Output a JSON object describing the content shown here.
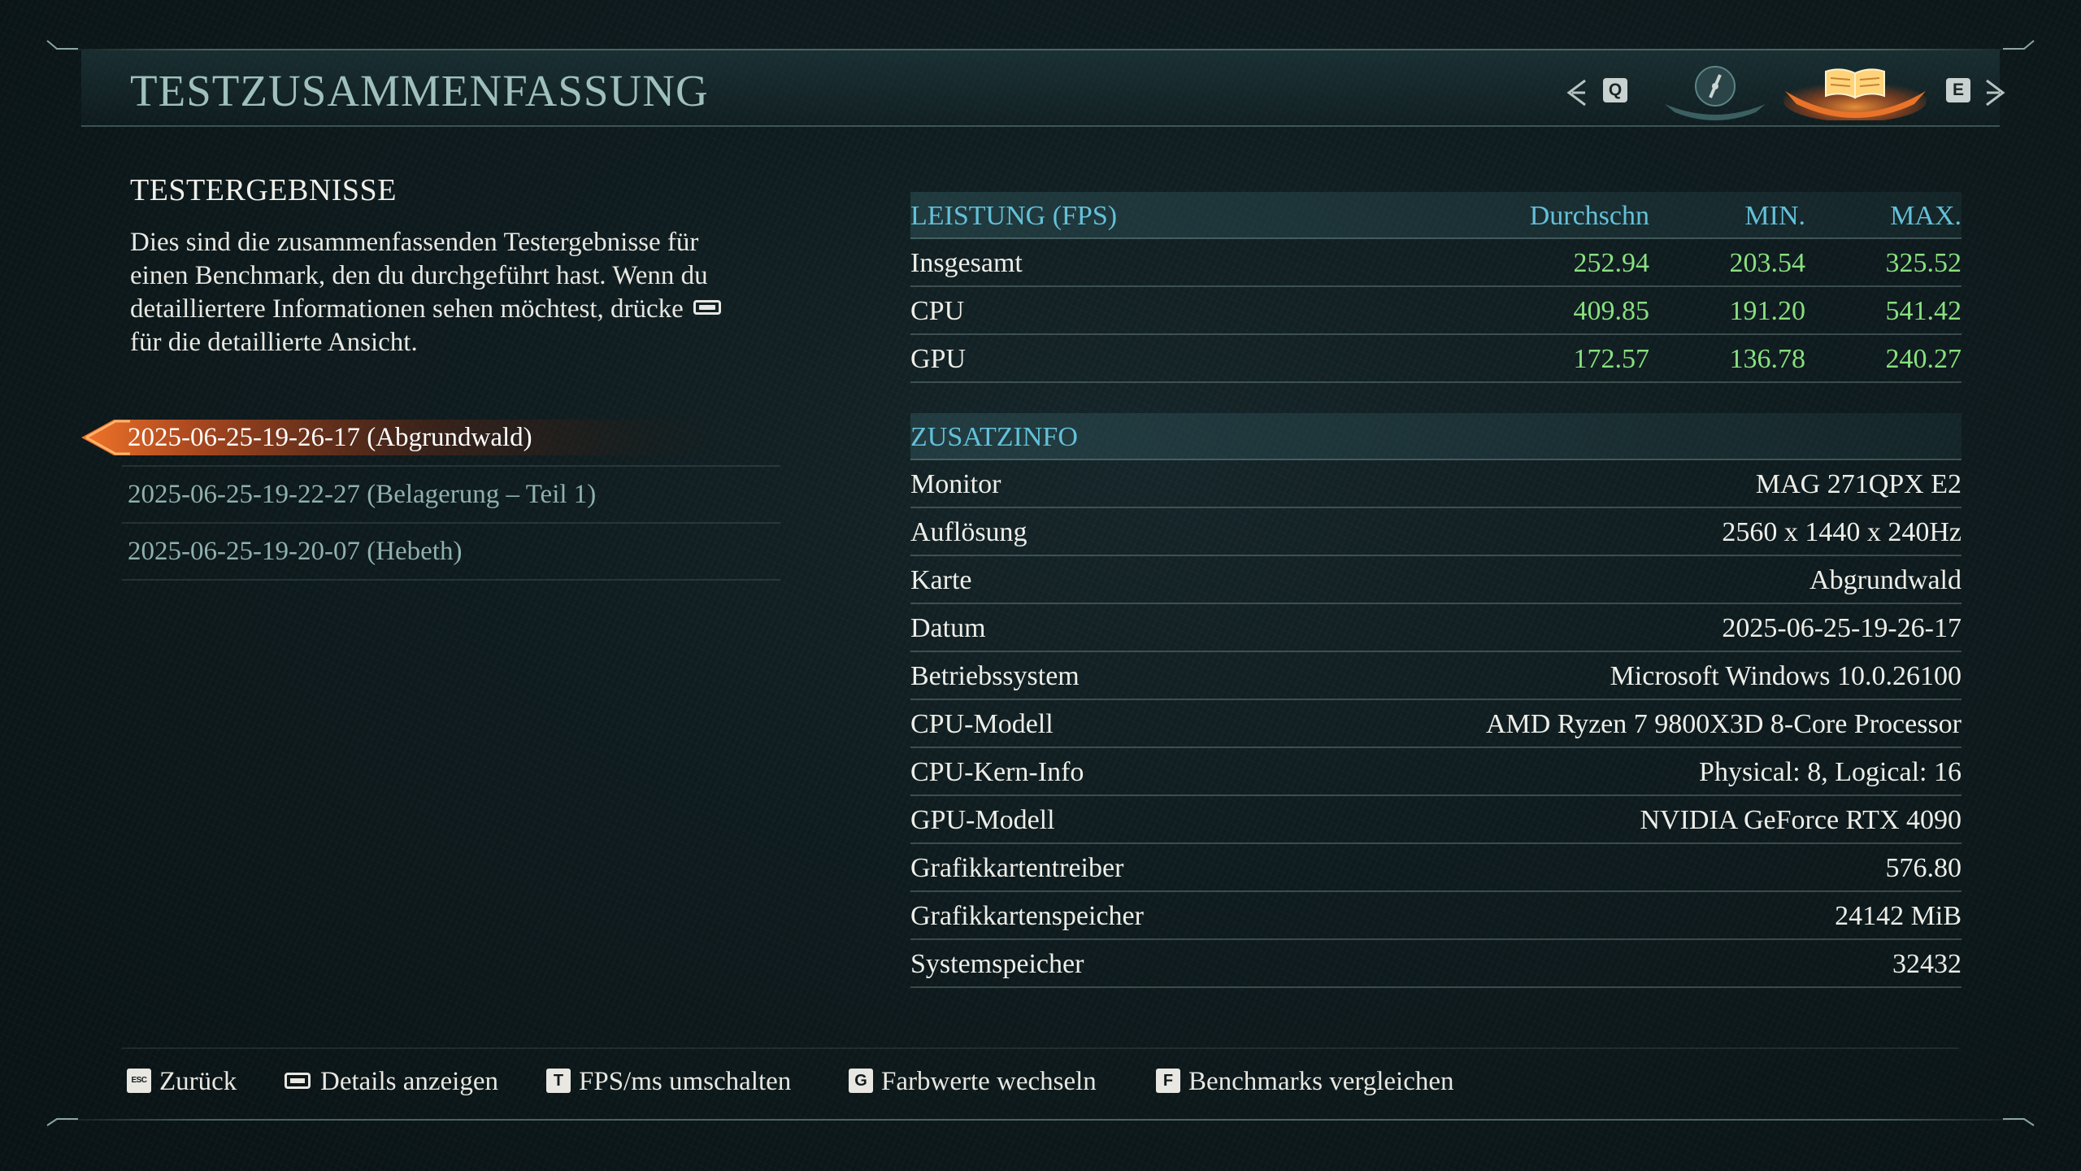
{
  "header": {
    "title": "TESTZUSAMMENFASSUNG",
    "prev_key": "Q",
    "next_key": "E",
    "tabs": [
      {
        "icon": "compass-icon",
        "active": false
      },
      {
        "icon": "book-icon",
        "active": true
      }
    ]
  },
  "left": {
    "heading": "TESTERGEBNISSE",
    "description_part1": "Dies sind die zusammenfassenden Testergebnisse für einen Benchmark, den du durchgeführt hast. Wenn du detailliertere Informationen sehen möchtest, drücke",
    "description_part2": "für die detaillierte Ansicht.",
    "runs": [
      {
        "label": "2025-06-25-19-26-17 (Abgrundwald)",
        "selected": true
      },
      {
        "label": "2025-06-25-19-22-27 (Belagerung – Teil 1)",
        "selected": false
      },
      {
        "label": "2025-06-25-19-20-07 (Hebeth)",
        "selected": false
      }
    ]
  },
  "performance": {
    "title": "LEISTUNG (FPS)",
    "columns": [
      "Durchschn",
      "MIN.",
      "MAX."
    ],
    "rows": [
      {
        "label": "Insgesamt",
        "avg": "252.94",
        "min": "203.54",
        "max": "325.52"
      },
      {
        "label": "CPU",
        "avg": "409.85",
        "min": "191.20",
        "max": "541.42"
      },
      {
        "label": "GPU",
        "avg": "172.57",
        "min": "136.78",
        "max": "240.27"
      }
    ]
  },
  "info": {
    "title": "ZUSATZINFO",
    "rows": [
      {
        "label": "Monitor",
        "value": "MAG 271QPX E2"
      },
      {
        "label": "Auflösung",
        "value": "2560 x 1440 x 240Hz"
      },
      {
        "label": "Karte",
        "value": "Abgrundwald"
      },
      {
        "label": "Datum",
        "value": "2025-06-25-19-26-17"
      },
      {
        "label": "Betriebssystem",
        "value": "Microsoft Windows 10.0.26100"
      },
      {
        "label": "CPU-Modell",
        "value": "AMD Ryzen 7 9800X3D 8-Core Processor"
      },
      {
        "label": "CPU-Kern-Info",
        "value": "Physical: 8, Logical: 16"
      },
      {
        "label": "GPU-Modell",
        "value": "NVIDIA GeForce RTX 4090"
      },
      {
        "label": "Grafikkartentreiber",
        "value": "576.80"
      },
      {
        "label": "Grafikkartenspeicher",
        "value": "24142 MiB"
      },
      {
        "label": "Systemspeicher",
        "value": "32432"
      }
    ]
  },
  "footer": {
    "back": {
      "key": "ESC",
      "label": "Zurück"
    },
    "details": {
      "key": "space",
      "label": "Details anzeigen"
    },
    "toggle": {
      "key": "T",
      "label": "FPS/ms umschalten"
    },
    "colors": {
      "key": "G",
      "label": "Farbwerte wechseln"
    },
    "compare": {
      "key": "F",
      "label": "Benchmarks vergleichen"
    }
  },
  "colors": {
    "accent_cyan": "#63c1d9",
    "value_green": "#89e07f",
    "title_teal": "#9fc0bd",
    "highlight_orange": "#e8742a"
  }
}
